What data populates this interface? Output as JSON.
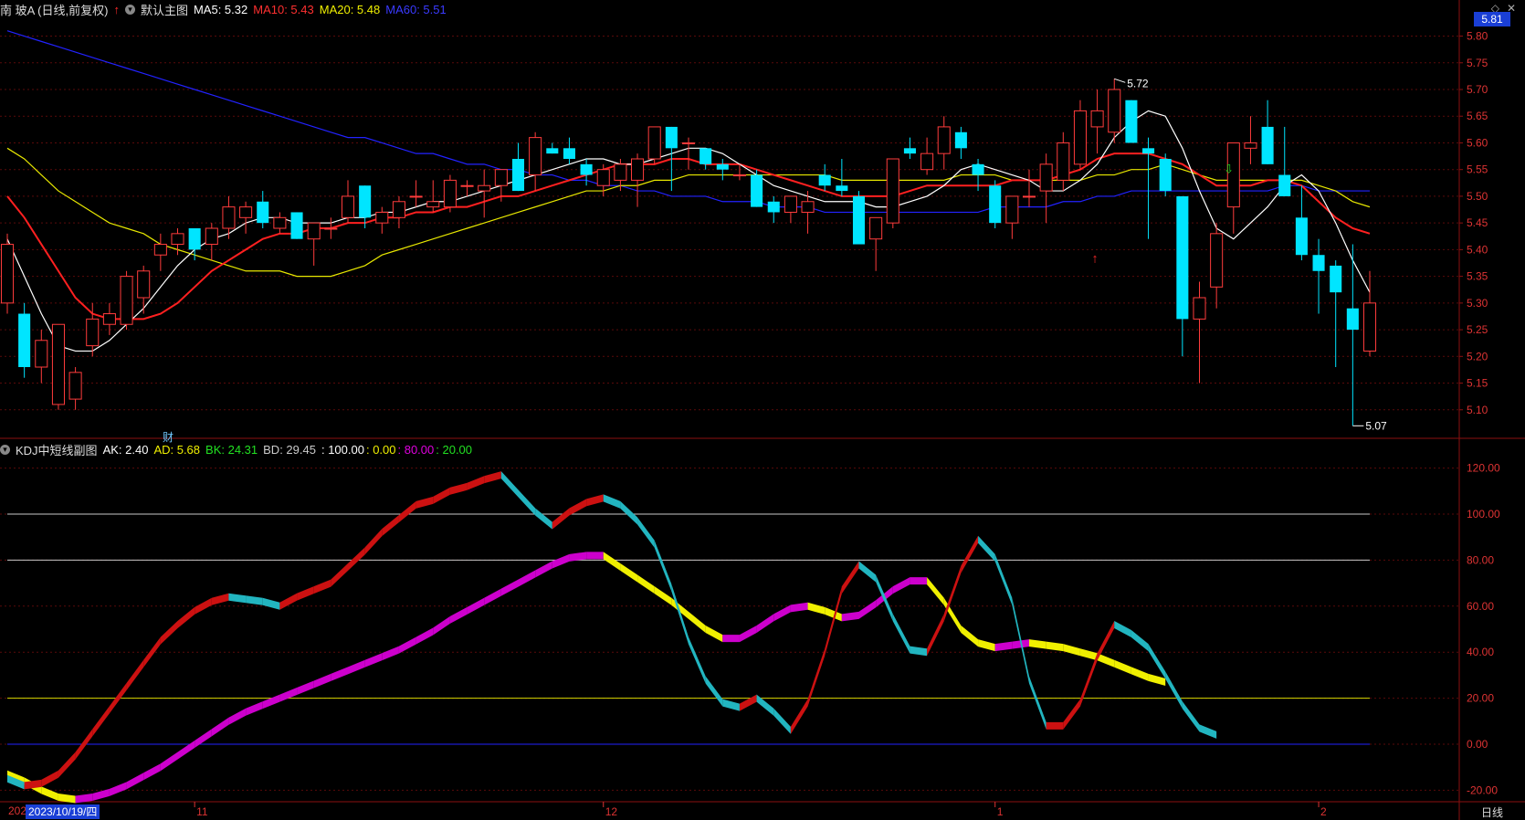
{
  "header": {
    "stock_name": "南 玻A (日线,前复权)",
    "main_chart_name": "默认主图",
    "ma5": "MA5: 5.32",
    "ma10": "MA10: 5.43",
    "ma20": "MA20: 5.48",
    "ma60": "MA60: 5.51"
  },
  "sub_header": {
    "indicator": "KDJ中短线副图",
    "ak": "AK: 2.40",
    "ad": "AD: 5.68",
    "bk": "BK: 24.31",
    "bd": "BD: 29.45",
    "l100": ": 100.00",
    "l0": ": 0.00",
    "l80": ": 80.00",
    "l20": ": 20.00"
  },
  "top_right": {
    "diamond_icon": "diamond-icon",
    "close_icon": "close-icon"
  },
  "current_price_box": "5.81",
  "price_axis": [
    "5.80",
    "5.75",
    "5.70",
    "5.65",
    "5.60",
    "5.55",
    "5.50",
    "5.45",
    "5.40",
    "5.35",
    "5.30",
    "5.25",
    "5.20",
    "5.15",
    "5.10"
  ],
  "kdj_axis": [
    "120.00",
    "100.00",
    "80.00",
    "60.00",
    "40.00",
    "20.00",
    "0.00",
    "-20.00"
  ],
  "annotations": {
    "high": "5.72",
    "low": "5.07",
    "finance_mark": "财"
  },
  "date_axis": {
    "prefix": "202",
    "selected": "2023/10/19/四",
    "month_labels": [
      "11",
      "12",
      "1",
      "2"
    ],
    "period": "日线"
  },
  "colors": {
    "up": "#ff3c3c",
    "down": "#00e5ff",
    "ma5": "#ffffff",
    "ma10": "#ff2020",
    "ma20": "#e8e800",
    "ma60": "#2222ff",
    "kdj_up": "#cc1111",
    "kdj_down": "#22b5c0",
    "d_up": "#cc00cc",
    "d_down": "#f0f000",
    "divider": "#8b1010"
  },
  "chart_data": {
    "type": "candlestick",
    "price_range": [
      5.05,
      5.83
    ],
    "kdj_range": [
      -25,
      125
    ],
    "candles": [
      {
        "o": 5.3,
        "h": 5.43,
        "l": 5.28,
        "c": 5.41
      },
      {
        "o": 5.28,
        "h": 5.3,
        "l": 5.16,
        "c": 5.18
      },
      {
        "o": 5.18,
        "h": 5.25,
        "l": 5.15,
        "c": 5.23
      },
      {
        "o": 5.11,
        "h": 5.26,
        "l": 5.1,
        "c": 5.26
      },
      {
        "o": 5.12,
        "h": 5.18,
        "l": 5.1,
        "c": 5.17
      },
      {
        "o": 5.22,
        "h": 5.3,
        "l": 5.2,
        "c": 5.27
      },
      {
        "o": 5.26,
        "h": 5.3,
        "l": 5.24,
        "c": 5.28
      },
      {
        "o": 5.26,
        "h": 5.36,
        "l": 5.25,
        "c": 5.35
      },
      {
        "o": 5.31,
        "h": 5.37,
        "l": 5.28,
        "c": 5.36
      },
      {
        "o": 5.39,
        "h": 5.43,
        "l": 5.36,
        "c": 5.41
      },
      {
        "o": 5.41,
        "h": 5.44,
        "l": 5.39,
        "c": 5.43
      },
      {
        "o": 5.44,
        "h": 5.44,
        "l": 5.38,
        "c": 5.4
      },
      {
        "o": 5.41,
        "h": 5.45,
        "l": 5.38,
        "c": 5.44
      },
      {
        "o": 5.44,
        "h": 5.5,
        "l": 5.42,
        "c": 5.48
      },
      {
        "o": 5.46,
        "h": 5.49,
        "l": 5.43,
        "c": 5.48
      },
      {
        "o": 5.49,
        "h": 5.51,
        "l": 5.44,
        "c": 5.45
      },
      {
        "o": 5.44,
        "h": 5.47,
        "l": 5.43,
        "c": 5.46
      },
      {
        "o": 5.47,
        "h": 5.47,
        "l": 5.42,
        "c": 5.42
      },
      {
        "o": 5.42,
        "h": 5.45,
        "l": 5.37,
        "c": 5.45
      },
      {
        "o": 5.44,
        "h": 5.46,
        "l": 5.42,
        "c": 5.44
      },
      {
        "o": 5.46,
        "h": 5.53,
        "l": 5.45,
        "c": 5.5
      },
      {
        "o": 5.52,
        "h": 5.52,
        "l": 5.44,
        "c": 5.46
      },
      {
        "o": 5.45,
        "h": 5.48,
        "l": 5.43,
        "c": 5.47
      },
      {
        "o": 5.46,
        "h": 5.5,
        "l": 5.44,
        "c": 5.49
      },
      {
        "o": 5.5,
        "h": 5.53,
        "l": 5.48,
        "c": 5.5
      },
      {
        "o": 5.48,
        "h": 5.53,
        "l": 5.47,
        "c": 5.49
      },
      {
        "o": 5.48,
        "h": 5.54,
        "l": 5.47,
        "c": 5.53
      },
      {
        "o": 5.52,
        "h": 5.53,
        "l": 5.5,
        "c": 5.52
      },
      {
        "o": 5.51,
        "h": 5.55,
        "l": 5.46,
        "c": 5.52
      },
      {
        "o": 5.52,
        "h": 5.55,
        "l": 5.49,
        "c": 5.55
      },
      {
        "o": 5.57,
        "h": 5.6,
        "l": 5.51,
        "c": 5.51
      },
      {
        "o": 5.54,
        "h": 5.62,
        "l": 5.51,
        "c": 5.61
      },
      {
        "o": 5.59,
        "h": 5.6,
        "l": 5.58,
        "c": 5.58
      },
      {
        "o": 5.59,
        "h": 5.61,
        "l": 5.56,
        "c": 5.57
      },
      {
        "o": 5.56,
        "h": 5.57,
        "l": 5.52,
        "c": 5.54
      },
      {
        "o": 5.52,
        "h": 5.56,
        "l": 5.5,
        "c": 5.55
      },
      {
        "o": 5.53,
        "h": 5.57,
        "l": 5.51,
        "c": 5.56
      },
      {
        "o": 5.53,
        "h": 5.58,
        "l": 5.48,
        "c": 5.57
      },
      {
        "o": 5.57,
        "h": 5.63,
        "l": 5.56,
        "c": 5.63
      },
      {
        "o": 5.63,
        "h": 5.63,
        "l": 5.51,
        "c": 5.59
      },
      {
        "o": 5.6,
        "h": 5.61,
        "l": 5.55,
        "c": 5.6
      },
      {
        "o": 5.59,
        "h": 5.59,
        "l": 5.55,
        "c": 5.56
      },
      {
        "o": 5.56,
        "h": 5.57,
        "l": 5.53,
        "c": 5.55
      },
      {
        "o": 5.54,
        "h": 5.56,
        "l": 5.53,
        "c": 5.54
      },
      {
        "o": 5.54,
        "h": 5.55,
        "l": 5.48,
        "c": 5.48
      },
      {
        "o": 5.49,
        "h": 5.5,
        "l": 5.45,
        "c": 5.47
      },
      {
        "o": 5.47,
        "h": 5.5,
        "l": 5.45,
        "c": 5.5
      },
      {
        "o": 5.47,
        "h": 5.51,
        "l": 5.43,
        "c": 5.49
      },
      {
        "o": 5.54,
        "h": 5.56,
        "l": 5.51,
        "c": 5.52
      },
      {
        "o": 5.52,
        "h": 5.57,
        "l": 5.5,
        "c": 5.51
      },
      {
        "o": 5.5,
        "h": 5.51,
        "l": 5.41,
        "c": 5.41
      },
      {
        "o": 5.42,
        "h": 5.46,
        "l": 5.36,
        "c": 5.46
      },
      {
        "o": 5.45,
        "h": 5.56,
        "l": 5.44,
        "c": 5.57
      },
      {
        "o": 5.59,
        "h": 5.61,
        "l": 5.57,
        "c": 5.58
      },
      {
        "o": 5.55,
        "h": 5.61,
        "l": 5.54,
        "c": 5.58
      },
      {
        "o": 5.58,
        "h": 5.65,
        "l": 5.55,
        "c": 5.63
      },
      {
        "o": 5.62,
        "h": 5.63,
        "l": 5.57,
        "c": 5.59
      },
      {
        "o": 5.56,
        "h": 5.57,
        "l": 5.51,
        "c": 5.54
      },
      {
        "o": 5.52,
        "h": 5.53,
        "l": 5.44,
        "c": 5.45
      },
      {
        "o": 5.45,
        "h": 5.5,
        "l": 5.42,
        "c": 5.5
      },
      {
        "o": 5.5,
        "h": 5.55,
        "l": 5.48,
        "c": 5.5
      },
      {
        "o": 5.51,
        "h": 5.58,
        "l": 5.45,
        "c": 5.56
      },
      {
        "o": 5.53,
        "h": 5.62,
        "l": 5.51,
        "c": 5.6
      },
      {
        "o": 5.56,
        "h": 5.68,
        "l": 5.55,
        "c": 5.66
      },
      {
        "o": 5.63,
        "h": 5.7,
        "l": 5.58,
        "c": 5.66
      },
      {
        "o": 5.62,
        "h": 5.72,
        "l": 5.6,
        "c": 5.7
      },
      {
        "o": 5.68,
        "h": 5.68,
        "l": 5.6,
        "c": 5.6
      },
      {
        "o": 5.59,
        "h": 5.61,
        "l": 5.42,
        "c": 5.58
      },
      {
        "o": 5.57,
        "h": 5.58,
        "l": 5.5,
        "c": 5.51
      },
      {
        "o": 5.5,
        "h": 5.5,
        "l": 5.2,
        "c": 5.27
      },
      {
        "o": 5.27,
        "h": 5.34,
        "l": 5.15,
        "c": 5.31
      },
      {
        "o": 5.33,
        "h": 5.45,
        "l": 5.29,
        "c": 5.43
      },
      {
        "o": 5.48,
        "h": 5.6,
        "l": 5.43,
        "c": 5.6
      },
      {
        "o": 5.59,
        "h": 5.65,
        "l": 5.56,
        "c": 5.6
      },
      {
        "o": 5.63,
        "h": 5.68,
        "l": 5.56,
        "c": 5.56
      },
      {
        "o": 5.54,
        "h": 5.63,
        "l": 5.5,
        "c": 5.5
      },
      {
        "o": 5.46,
        "h": 5.52,
        "l": 5.38,
        "c": 5.39
      },
      {
        "o": 5.39,
        "h": 5.42,
        "l": 5.28,
        "c": 5.36
      },
      {
        "o": 5.37,
        "h": 5.38,
        "l": 5.18,
        "c": 5.32
      },
      {
        "o": 5.29,
        "h": 5.41,
        "l": 5.07,
        "c": 5.25
      },
      {
        "o": 5.21,
        "h": 5.36,
        "l": 5.2,
        "c": 5.3
      }
    ],
    "ma5": [
      5.42,
      5.35,
      5.28,
      5.22,
      5.21,
      5.21,
      5.23,
      5.26,
      5.29,
      5.33,
      5.37,
      5.4,
      5.42,
      5.43,
      5.45,
      5.46,
      5.46,
      5.45,
      5.45,
      5.45,
      5.46,
      5.46,
      5.47,
      5.47,
      5.48,
      5.49,
      5.49,
      5.5,
      5.51,
      5.52,
      5.53,
      5.54,
      5.55,
      5.56,
      5.57,
      5.57,
      5.56,
      5.56,
      5.57,
      5.58,
      5.59,
      5.59,
      5.58,
      5.56,
      5.54,
      5.52,
      5.51,
      5.5,
      5.49,
      5.49,
      5.49,
      5.48,
      5.48,
      5.49,
      5.5,
      5.52,
      5.55,
      5.56,
      5.55,
      5.54,
      5.53,
      5.51,
      5.51,
      5.53,
      5.56,
      5.61,
      5.64,
      5.66,
      5.65,
      5.59,
      5.51,
      5.44,
      5.42,
      5.45,
      5.48,
      5.52,
      5.54,
      5.51,
      5.45,
      5.38,
      5.32
    ],
    "ma10": [
      5.5,
      5.46,
      5.41,
      5.36,
      5.31,
      5.28,
      5.27,
      5.27,
      5.27,
      5.28,
      5.3,
      5.33,
      5.36,
      5.38,
      5.4,
      5.42,
      5.43,
      5.43,
      5.44,
      5.44,
      5.45,
      5.45,
      5.46,
      5.46,
      5.47,
      5.47,
      5.48,
      5.48,
      5.49,
      5.5,
      5.5,
      5.51,
      5.52,
      5.53,
      5.54,
      5.55,
      5.56,
      5.56,
      5.56,
      5.57,
      5.57,
      5.56,
      5.56,
      5.56,
      5.55,
      5.54,
      5.53,
      5.52,
      5.51,
      5.5,
      5.5,
      5.5,
      5.5,
      5.51,
      5.52,
      5.52,
      5.52,
      5.52,
      5.52,
      5.53,
      5.53,
      5.53,
      5.54,
      5.55,
      5.57,
      5.58,
      5.58,
      5.58,
      5.57,
      5.56,
      5.54,
      5.52,
      5.52,
      5.52,
      5.53,
      5.53,
      5.52,
      5.49,
      5.46,
      5.44,
      5.43
    ],
    "ma20": [
      5.59,
      5.57,
      5.54,
      5.51,
      5.49,
      5.47,
      5.45,
      5.44,
      5.43,
      5.41,
      5.4,
      5.39,
      5.38,
      5.37,
      5.36,
      5.36,
      5.36,
      5.35,
      5.35,
      5.35,
      5.36,
      5.37,
      5.39,
      5.4,
      5.41,
      5.42,
      5.43,
      5.44,
      5.45,
      5.46,
      5.47,
      5.48,
      5.49,
      5.5,
      5.51,
      5.51,
      5.52,
      5.52,
      5.53,
      5.53,
      5.54,
      5.54,
      5.54,
      5.54,
      5.54,
      5.54,
      5.54,
      5.54,
      5.54,
      5.53,
      5.53,
      5.53,
      5.53,
      5.53,
      5.53,
      5.53,
      5.54,
      5.54,
      5.54,
      5.53,
      5.53,
      5.53,
      5.53,
      5.53,
      5.54,
      5.54,
      5.55,
      5.55,
      5.56,
      5.55,
      5.54,
      5.53,
      5.53,
      5.53,
      5.53,
      5.53,
      5.53,
      5.52,
      5.51,
      5.49,
      5.48
    ],
    "ma60": [
      5.81,
      5.8,
      5.79,
      5.78,
      5.77,
      5.76,
      5.75,
      5.74,
      5.73,
      5.72,
      5.71,
      5.7,
      5.69,
      5.68,
      5.67,
      5.66,
      5.65,
      5.64,
      5.63,
      5.62,
      5.61,
      5.61,
      5.6,
      5.59,
      5.58,
      5.58,
      5.57,
      5.56,
      5.56,
      5.55,
      5.55,
      5.54,
      5.54,
      5.53,
      5.53,
      5.52,
      5.52,
      5.51,
      5.51,
      5.5,
      5.5,
      5.5,
      5.49,
      5.49,
      5.49,
      5.48,
      5.48,
      5.48,
      5.47,
      5.47,
      5.47,
      5.47,
      5.47,
      5.47,
      5.47,
      5.47,
      5.47,
      5.47,
      5.48,
      5.48,
      5.48,
      5.48,
      5.49,
      5.49,
      5.5,
      5.5,
      5.51,
      5.51,
      5.51,
      5.51,
      5.51,
      5.51,
      5.51,
      5.51,
      5.51,
      5.52,
      5.52,
      5.51,
      5.51,
      5.51,
      5.51
    ],
    "kdj_k": [
      -15,
      -18,
      -17,
      -13,
      -5,
      5,
      15,
      25,
      35,
      45,
      52,
      58,
      62,
      64,
      63,
      62,
      60,
      64,
      67,
      70,
      77,
      84,
      92,
      98,
      104,
      106,
      110,
      112,
      115,
      117,
      109,
      101,
      95,
      101,
      105,
      107,
      104,
      97,
      87,
      68,
      45,
      28,
      18,
      16,
      20,
      14,
      6,
      18,
      40,
      67,
      78,
      72,
      55,
      41,
      40,
      55,
      76,
      89,
      81,
      62,
      28,
      8,
      8,
      18,
      38,
      52,
      48,
      42,
      30,
      17,
      7,
      4
    ],
    "kdj_d": [
      -13,
      -16,
      -20,
      -23,
      -24,
      -23,
      -21,
      -18,
      -14,
      -10,
      -5,
      0,
      5,
      10,
      14,
      17,
      20,
      23,
      26,
      29,
      32,
      35,
      38,
      41,
      45,
      49,
      54,
      58,
      62,
      66,
      70,
      74,
      78,
      81,
      82,
      82,
      77,
      72,
      67,
      62,
      56,
      50,
      46,
      46,
      50,
      55,
      59,
      60,
      58,
      55,
      56,
      61,
      67,
      71,
      71,
      62,
      50,
      44,
      42,
      43,
      44,
      43,
      42,
      40,
      38,
      35,
      32,
      29,
      27
    ],
    "high_label": "5.72",
    "low_label": "5.07"
  }
}
